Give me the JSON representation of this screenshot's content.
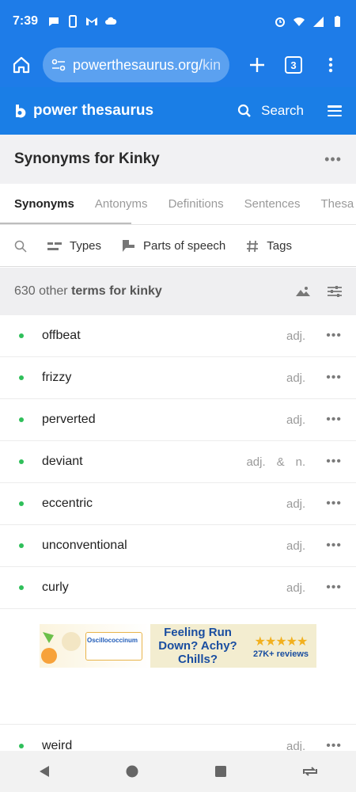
{
  "status_bar": {
    "time": "7:39"
  },
  "browser": {
    "url_main": "powerthesaurus.org/",
    "url_rest": "kinl",
    "tab_count": "3"
  },
  "site": {
    "logo_text": "power thesaurus",
    "search_label": "Search"
  },
  "page": {
    "title": "Synonyms for Kinky"
  },
  "tabs": [
    {
      "label": "Synonyms"
    },
    {
      "label": "Antonyms"
    },
    {
      "label": "Definitions"
    },
    {
      "label": "Sentences"
    },
    {
      "label": "Thesa"
    }
  ],
  "filters": {
    "types": "Types",
    "parts_of_speech": "Parts of speech",
    "tags": "Tags"
  },
  "count": {
    "prefix": "630 other",
    "suffix": "terms for kinky"
  },
  "terms": [
    {
      "word": "offbeat",
      "pos": "adj."
    },
    {
      "word": "frizzy",
      "pos": "adj."
    },
    {
      "word": "perverted",
      "pos": "adj."
    },
    {
      "word": "deviant",
      "pos": "adj.",
      "pos2": "n.",
      "joiner": "&"
    },
    {
      "word": "eccentric",
      "pos": "adj."
    },
    {
      "word": "unconventional",
      "pos": "adj."
    },
    {
      "word": "curly",
      "pos": "adj."
    }
  ],
  "ad": {
    "brand": "Oscillococcinum",
    "headline": "Feeling Run Down? Achy? Chills?",
    "stars": "★★★★★",
    "reviews": "27K+ reviews"
  },
  "partial_term": {
    "word": "weird",
    "pos": "adj."
  },
  "colors": {
    "primary": "#1e7ce8",
    "bullet": "#2fbf5a"
  }
}
